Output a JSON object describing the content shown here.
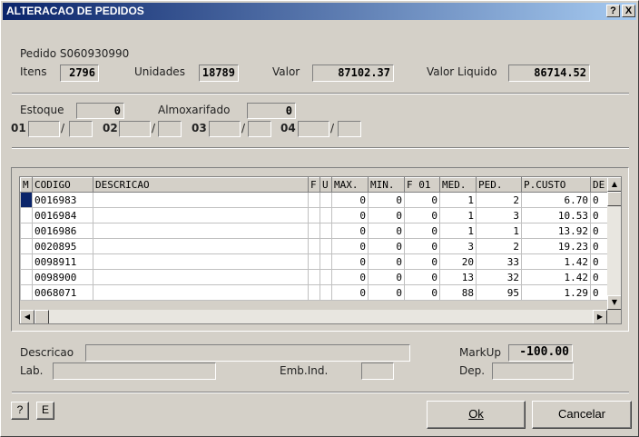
{
  "window": {
    "title": "ALTERACAO DE PEDIDOS",
    "help_btn": "?",
    "close_btn": "X"
  },
  "header": {
    "pedido": "Pedido S060930990",
    "itens_label": "Itens",
    "itens_value": "2796",
    "unidades_label": "Unidades",
    "unidades_value": "18789",
    "valor_label": "Valor",
    "valor_value": "87102.37",
    "valor_liquido_label": "Valor Liquido",
    "valor_liquido_value": "86714.52"
  },
  "stock": {
    "estoque_label": "Estoque",
    "estoque_value": "0",
    "almox_label": "Almoxarifado",
    "almox_value": "0",
    "slots": [
      {
        "label": "01",
        "sep": "/"
      },
      {
        "label": "02",
        "sep": "/"
      },
      {
        "label": "03",
        "sep": "/"
      },
      {
        "label": "04",
        "sep": "/"
      }
    ]
  },
  "grid": {
    "columns": [
      "M",
      "CODIGO",
      "DESCRICAO",
      "F",
      "U",
      "MAX.",
      "MIN.",
      "F 01",
      "MED.",
      "PED.",
      "P.CUSTO",
      "DE"
    ],
    "rows": [
      {
        "codigo": "0016983",
        "descricao": "",
        "f": "",
        "u": "",
        "max": "0",
        "min": "0",
        "f01": "0",
        "med": "1",
        "ped": "2",
        "pcusto": "6.70",
        "de": "0"
      },
      {
        "codigo": "0016984",
        "descricao": "",
        "f": "",
        "u": "",
        "max": "0",
        "min": "0",
        "f01": "0",
        "med": "1",
        "ped": "3",
        "pcusto": "10.53",
        "de": "0"
      },
      {
        "codigo": "0016986",
        "descricao": "",
        "f": "",
        "u": "",
        "max": "0",
        "min": "0",
        "f01": "0",
        "med": "1",
        "ped": "1",
        "pcusto": "13.92",
        "de": "0"
      },
      {
        "codigo": "0020895",
        "descricao": "",
        "f": "",
        "u": "",
        "max": "0",
        "min": "0",
        "f01": "0",
        "med": "3",
        "ped": "2",
        "pcusto": "19.23",
        "de": "0"
      },
      {
        "codigo": "0098911",
        "descricao": "",
        "f": "",
        "u": "",
        "max": "0",
        "min": "0",
        "f01": "0",
        "med": "20",
        "ped": "33",
        "pcusto": "1.42",
        "de": "0"
      },
      {
        "codigo": "0098900",
        "descricao": "",
        "f": "",
        "u": "",
        "max": "0",
        "min": "0",
        "f01": "0",
        "med": "13",
        "ped": "32",
        "pcusto": "1.42",
        "de": "0"
      },
      {
        "codigo": "0068071",
        "descricao": "",
        "f": "",
        "u": "",
        "max": "0",
        "min": "0",
        "f01": "0",
        "med": "88",
        "ped": "95",
        "pcusto": "1.29",
        "de": "0"
      }
    ]
  },
  "detail": {
    "descricao_label": "Descricao",
    "descricao_value": "",
    "lab_label": "Lab.",
    "lab_value": "",
    "emb_label": "Emb.Ind.",
    "emb_value": "",
    "markup_label": "MarkUp",
    "markup_value": "-100.00",
    "dep_label": "Dep.",
    "dep_value": ""
  },
  "footer": {
    "help_label": "?",
    "e_label": "E",
    "ok_label": "Ok",
    "cancel_label": "Cancelar"
  }
}
